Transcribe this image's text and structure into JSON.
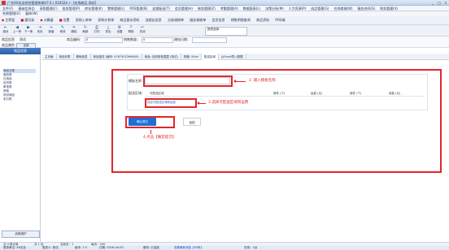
{
  "window": {
    "title": "广东XX实业综合管理系统V7.0 ( 010524 ) - [在线商品 测试]",
    "controls": [
      "_",
      "□",
      "×"
    ]
  },
  "menu": [
    "文件(F)",
    "基础信息(J)",
    "采购管理(C)",
    "批发管理(P)",
    "库存管理(K)",
    "零售管理(L)",
    "POS管理(B)",
    "连锁配送(T)",
    "会员管理(H)",
    "账务管理(Z)",
    "考勤管理(A)",
    "数据报表(L)",
    "决策分析(M)",
    "人力资源(P)",
    "成品管理(G)",
    "在线商城(W)",
    "服务合同(S)",
    "财务管理(X)",
    "窗口(W)",
    "帮助(H)"
  ],
  "submenu": [
    "系统管理(U)",
    "窗体(W)"
  ],
  "toolbar1": [
    {
      "icon": "◆",
      "label": "主界面"
    },
    {
      "icon": "■",
      "label": "通讯录"
    },
    {
      "icon": "◆",
      "label": "计算器"
    },
    {
      "icon": "■",
      "label": "设置"
    },
    {
      "icon": "",
      "label": "采购入库单"
    },
    {
      "icon": "",
      "label": "采购计划单"
    },
    {
      "icon": "",
      "label": "商品基本资料"
    },
    {
      "icon": "",
      "label": "连锁店信息"
    },
    {
      "icon": "",
      "label": "分部调拨单"
    },
    {
      "icon": "",
      "label": "服务调拨单"
    },
    {
      "icon": "",
      "label": "会员信息"
    },
    {
      "icon": "",
      "label": "销售明细查询"
    },
    {
      "icon": "",
      "label": "商品资料"
    },
    {
      "icon": "",
      "label": "POS端"
    }
  ],
  "toolbar2": [
    {
      "icon": "⇤",
      "label": "首页"
    },
    {
      "icon": "◀",
      "label": "上一条"
    },
    {
      "icon": "▶",
      "label": "下一条"
    },
    {
      "icon": "⇥",
      "label": "末页"
    },
    {
      "icon": "+",
      "label": "新增"
    },
    {
      "icon": "✎",
      "label": "修改"
    },
    {
      "icon": "✕",
      "label": "删除"
    },
    {
      "icon": "↻",
      "label": "刷新"
    },
    {
      "icon": "⎙",
      "label": "打印"
    },
    {
      "icon": "⤓",
      "label": "导出"
    },
    {
      "icon": "⚙",
      "label": "设置"
    },
    {
      "icon": "?",
      "label": "帮助"
    },
    {
      "icon": "↩",
      "label": "关闭"
    }
  ],
  "toolbar2_select": "报表选择：",
  "filter": {
    "store_label": "商品信息",
    "store_value": "测试",
    "code_label": "商品编码：",
    "code_value": "0",
    "qty_label": "销售数量：",
    "qty_value": "0",
    "date_label": "建档日期：",
    "status_label": "商品属性：",
    "reset_label": "全部"
  },
  "left_panel": {
    "header": "商品信息",
    "tree": [
      "商品分类",
      "食品类",
      "日用品",
      "百货类",
      "家电类",
      "其他",
      "测试商品",
      "未分类"
    ],
    "selected_index": 0,
    "maintain_label": "品类维护"
  },
  "tabs": [
    "主页面",
    "商品列表",
    "基础信息",
    "商品描述 (编号: 9787302269649)",
    "商品: 自然堂保湿霜 (测试)",
    "规格: 50ml",
    "配送区域",
    "从Excel导入数据"
  ],
  "active_tab_index": 6,
  "form": {
    "name_label": "模板名称：",
    "region_label": "配送区域：",
    "region_col": "可配送区域",
    "first_weight": "首件 (个)",
    "first_fee": "运费 (元)",
    "add_weight": "续件 (个)",
    "add_fee": "续费 (元)",
    "region_link": "指定可配送区域和运费",
    "confirm_label": "确认提交",
    "return_label": "返回"
  },
  "annotations": {
    "step2": "2. 输入模板名称",
    "step3": "3.选择可配送区域和运费",
    "step4": "4.点击【确定提交】"
  },
  "status": {
    "bar1": [
      "共 4 条记录",
      "共 1 页",
      "当前页：1",
      "每页：200"
    ],
    "bar2": [
      "登录单位: XX实业",
      "登录人: 测试",
      "版本: 7.0",
      "日期: 2016-09-03",
      "服务: 已连接",
      "在线：1台"
    ],
    "link": "查看最新消息【60条】"
  },
  "colors": {
    "accent": "#1f6fd6",
    "annotation": "#e2262a"
  }
}
